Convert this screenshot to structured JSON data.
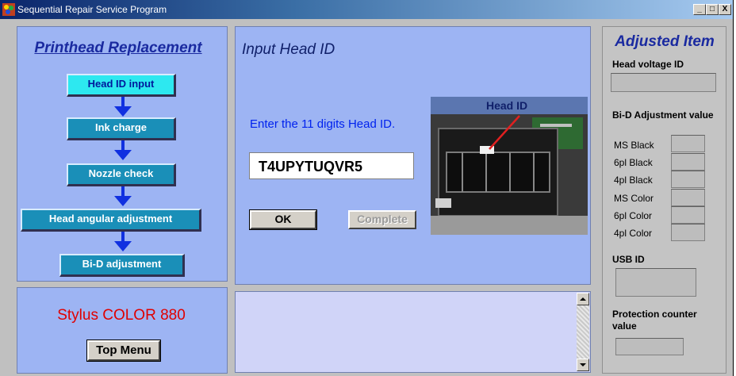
{
  "window": {
    "title": "Sequential Repair Service Program",
    "controls": [
      "_",
      "□",
      "X"
    ]
  },
  "steps_panel": {
    "title": "Printhead Replacement",
    "steps": [
      {
        "label": "Head ID input",
        "active": true
      },
      {
        "label": "Ink charge",
        "active": false
      },
      {
        "label": "Nozzle check",
        "active": false
      },
      {
        "label": "Head angular adjustment",
        "active": false
      },
      {
        "label": "Bi-D adjustment",
        "active": false
      }
    ],
    "arrow_color": "#1030e0"
  },
  "model_panel": {
    "model": "Stylus COLOR 880",
    "top_menu_label": "Top Menu"
  },
  "input_panel": {
    "title": "Input Head ID",
    "prompt": "Enter the 11 digits Head ID.",
    "head_id_value": "T4UPYTUQVR5",
    "ok_label": "OK",
    "complete_label": "Complete",
    "photo_label": "Head ID"
  },
  "adjusted_panel": {
    "title": "Adjusted Item",
    "head_voltage_label": "Head voltage ID",
    "bid_label": "Bi-D Adjustment value",
    "bid_items": [
      "MS Black",
      "6pl Black",
      "4pl Black",
      "MS Color",
      "6pl Color",
      "4pl Color"
    ],
    "usb_label": "USB ID",
    "protection_label": "Protection counter value"
  },
  "colors": {
    "panel_bg": "#9db4f3",
    "step_bg": "#1a8fb8",
    "step_active_bg": "#2de8f0",
    "model_text": "#e00000",
    "prompt_text": "#0022ee"
  }
}
